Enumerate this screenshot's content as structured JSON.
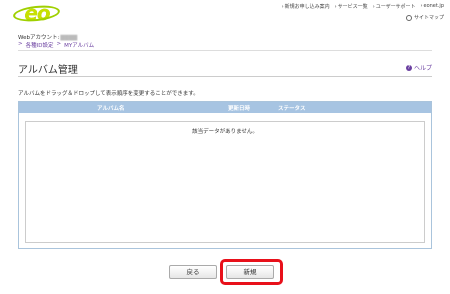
{
  "brand": {
    "logo_text": "eo",
    "logo_color": "#c8e000"
  },
  "top_nav": {
    "items": [
      "新規お申し込み案内",
      "サービス一覧",
      "ユーザーサポート",
      "eonet.jp"
    ],
    "sitemap_label": "サイトマップ"
  },
  "account": {
    "label": "Webアカウント:",
    "value": ""
  },
  "breadcrumb": {
    "items": [
      "各種ID設定",
      "MYアルバム"
    ],
    "separator": ">"
  },
  "page": {
    "title": "アルバム管理",
    "help_label": "ヘルプ",
    "instruction": "アルバムをドラッグ＆ドロップして表示順序を変更することができます。"
  },
  "table": {
    "columns": [
      "アルバム名",
      "更新日時",
      "ステータス"
    ],
    "empty_message": "該当データがありません。",
    "header_color": "#a7c4e2"
  },
  "buttons": {
    "back_label": "戻る",
    "new_label": "新規"
  },
  "accent": {
    "highlight_color": "#e8101a",
    "link_color": "#6a3fa0"
  }
}
